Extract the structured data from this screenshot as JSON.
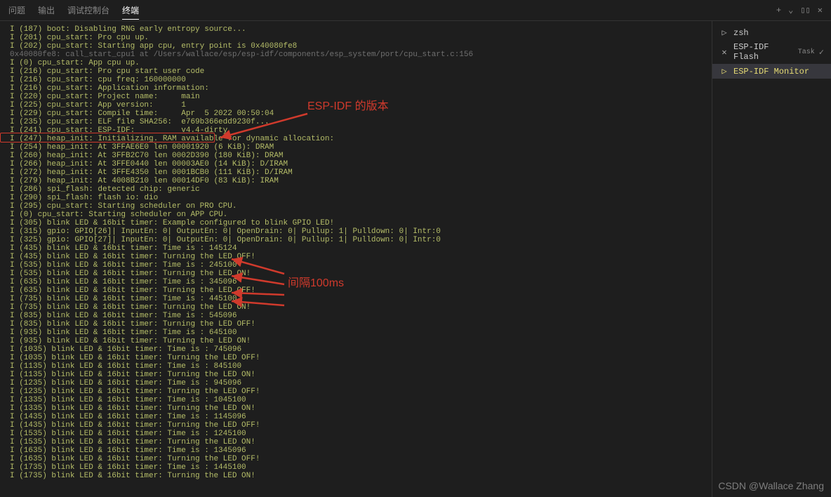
{
  "tabs": {
    "problems": "问题",
    "output": "输出",
    "debug": "调试控制台",
    "terminal": "终端"
  },
  "topActions": {
    "plus": "+",
    "chevron": "⌄",
    "split": "▯▯",
    "close": "✕"
  },
  "sidebar": {
    "items": [
      {
        "icon": "▷",
        "label": "zsh",
        "sub": "",
        "active": false,
        "check": false
      },
      {
        "icon": "✕",
        "label": "ESP-IDF Flash",
        "sub": "Task",
        "active": false,
        "check": true
      },
      {
        "icon": "▷",
        "label": "ESP-IDF Monitor",
        "sub": "",
        "active": true,
        "check": false
      }
    ]
  },
  "annotations": {
    "version": "ESP-IDF 的版本",
    "interval": "间隔100ms"
  },
  "watermark": "CSDN @Wallace Zhang",
  "log": [
    "I (187) boot: Disabling RNG early entropy source...",
    "I (201) cpu_start: Pro cpu up.",
    "I (202) cpu_start: Starting app cpu, entry point is 0x40080fe8",
    "0x40080fe8: call_start_cpu1 at /Users/wallace/esp/esp-idf/components/esp_system/port/cpu_start.c:156",
    "",
    "I (0) cpu_start: App cpu up.",
    "I (216) cpu_start: Pro cpu start user code",
    "I (216) cpu_start: cpu freq: 160000000",
    "I (216) cpu_start: Application information:",
    "I (220) cpu_start: Project name:     main",
    "I (225) cpu_start: App version:      1",
    "I (229) cpu_start: Compile time:     Apr  5 2022 00:50:04",
    "I (235) cpu_start: ELF file SHA256:  e769b366edd9230f...",
    "I (241) cpu_start: ESP-IDF:          v4.4-dirty",
    "I (247) heap_init: Initializing. RAM available for dynamic allocation:",
    "I (254) heap_init: At 3FFAE6E0 len 00001920 (6 KiB): DRAM",
    "I (260) heap_init: At 3FFB2C70 len 0002D390 (180 KiB): DRAM",
    "I (266) heap_init: At 3FFE0440 len 00003AE0 (14 KiB): D/IRAM",
    "I (272) heap_init: At 3FFE4350 len 0001BCB0 (111 KiB): D/IRAM",
    "I (279) heap_init: At 4008B210 len 00014DF0 (83 KiB): IRAM",
    "I (286) spi_flash: detected chip: generic",
    "I (290) spi_flash: flash io: dio",
    "I (295) cpu_start: Starting scheduler on PRO CPU.",
    "I (0) cpu_start: Starting scheduler on APP CPU.",
    "I (305) blink LED & 16bit timer: Example configured to blink GPIO LED!",
    "I (315) gpio: GPIO[26]| InputEn: 0| OutputEn: 0| OpenDrain: 0| Pullup: 1| Pulldown: 0| Intr:0",
    "I (325) gpio: GPIO[27]| InputEn: 0| OutputEn: 0| OpenDrain: 0| Pullup: 1| Pulldown: 0| Intr:0",
    "I (435) blink LED & 16bit timer: Time is : 145124",
    "I (435) blink LED & 16bit timer: Turning the LED OFF!",
    "I (535) blink LED & 16bit timer: Time is : 245100",
    "I (535) blink LED & 16bit timer: Turning the LED ON!",
    "I (635) blink LED & 16bit timer: Time is : 345096",
    "I (635) blink LED & 16bit timer: Turning the LED OFF!",
    "I (735) blink LED & 16bit timer: Time is : 445100",
    "I (735) blink LED & 16bit timer: Turning the LED ON!",
    "I (835) blink LED & 16bit timer: Time is : 545096",
    "I (835) blink LED & 16bit timer: Turning the LED OFF!",
    "I (935) blink LED & 16bit timer: Time is : 645100",
    "I (935) blink LED & 16bit timer: Turning the LED ON!",
    "I (1035) blink LED & 16bit timer: Time is : 745096",
    "I (1035) blink LED & 16bit timer: Turning the LED OFF!",
    "I (1135) blink LED & 16bit timer: Time is : 845100",
    "I (1135) blink LED & 16bit timer: Turning the LED ON!",
    "I (1235) blink LED & 16bit timer: Time is : 945096",
    "I (1235) blink LED & 16bit timer: Turning the LED OFF!",
    "I (1335) blink LED & 16bit timer: Time is : 1045100",
    "I (1335) blink LED & 16bit timer: Turning the LED ON!",
    "I (1435) blink LED & 16bit timer: Time is : 1145096",
    "I (1435) blink LED & 16bit timer: Turning the LED OFF!",
    "I (1535) blink LED & 16bit timer: Time is : 1245100",
    "I (1535) blink LED & 16bit timer: Turning the LED ON!",
    "I (1635) blink LED & 16bit timer: Time is : 1345096",
    "I (1635) blink LED & 16bit timer: Turning the LED OFF!",
    "I (1735) blink LED & 16bit timer: Time is : 1445100",
    "I (1735) blink LED & 16bit timer: Turning the LED ON!"
  ]
}
